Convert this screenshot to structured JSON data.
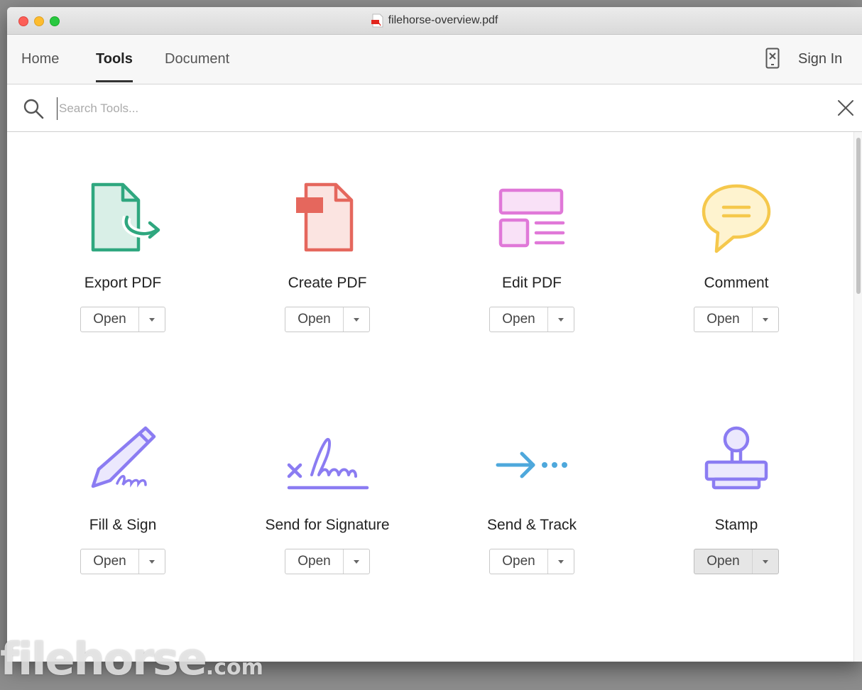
{
  "window": {
    "title": "filehorse-overview.pdf"
  },
  "nav": {
    "tabs": [
      {
        "label": "Home"
      },
      {
        "label": "Tools"
      },
      {
        "label": "Document"
      }
    ],
    "active_tab": "Tools",
    "sign_in_label": "Sign In"
  },
  "search": {
    "placeholder": "Search Tools...",
    "value": ""
  },
  "tools": [
    {
      "label": "Export PDF",
      "button": "Open",
      "icon": "export-pdf-icon",
      "color": "#2fa77f"
    },
    {
      "label": "Create PDF",
      "button": "Open",
      "icon": "create-pdf-icon",
      "color": "#e5675d"
    },
    {
      "label": "Edit PDF",
      "button": "Open",
      "icon": "edit-pdf-icon",
      "color": "#e078d8"
    },
    {
      "label": "Comment",
      "button": "Open",
      "icon": "comment-icon",
      "color": "#f5c84c"
    },
    {
      "label": "Fill & Sign",
      "button": "Open",
      "icon": "fill-sign-icon",
      "color": "#8b7cf2"
    },
    {
      "label": "Send for Signature",
      "button": "Open",
      "icon": "send-for-signature-icon",
      "color": "#8b7cf2"
    },
    {
      "label": "Send & Track",
      "button": "Open",
      "icon": "send-track-icon",
      "color": "#4ea8dc"
    },
    {
      "label": "Stamp",
      "button": "Open",
      "icon": "stamp-icon",
      "color": "#8b7cf2"
    }
  ],
  "watermark": {
    "brand": "filehorse",
    "suffix": ".com"
  }
}
